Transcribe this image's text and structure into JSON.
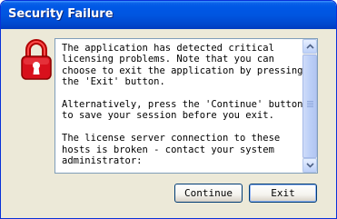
{
  "window": {
    "title": "Security Failure"
  },
  "icons": {
    "lock": "padlock-icon",
    "accent_color": "#e0101c"
  },
  "message": {
    "paragraphs": [
      "The application has detected critical\nlicensing problems. Note that you can\nchoose to exit the application by pressing\nthe 'Exit' button.",
      "Alternatively, press the 'Continue' button\nto save your session before you exit.",
      "The license server connection to these\nhosts is broken - contact your system\nadministrator:"
    ]
  },
  "buttons": {
    "continue_label": "Continue",
    "exit_label": "Exit"
  }
}
